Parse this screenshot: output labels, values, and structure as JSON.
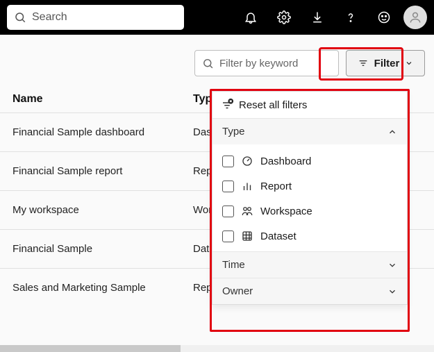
{
  "topbar": {
    "search_placeholder": "Search"
  },
  "toolbar": {
    "filter_keyword_placeholder": "Filter by keyword",
    "filter_button_label": "Filter"
  },
  "table": {
    "header_name": "Name",
    "header_type": "Type",
    "rows": [
      {
        "name": "Financial Sample dashboard",
        "type": "Dashboard"
      },
      {
        "name": "Financial Sample report",
        "type": "Report"
      },
      {
        "name": "My workspace",
        "type": "Workspace"
      },
      {
        "name": "Financial Sample",
        "type": "Dataset"
      },
      {
        "name": "Sales and Marketing Sample",
        "type": "Report"
      }
    ]
  },
  "filter_panel": {
    "reset_label": "Reset all filters",
    "sections": {
      "type": {
        "label": "Type",
        "expanded": true
      },
      "time": {
        "label": "Time",
        "expanded": false
      },
      "owner": {
        "label": "Owner",
        "expanded": false
      }
    },
    "type_options": [
      {
        "label": "Dashboard"
      },
      {
        "label": "Report"
      },
      {
        "label": "Workspace"
      },
      {
        "label": "Dataset"
      }
    ]
  }
}
